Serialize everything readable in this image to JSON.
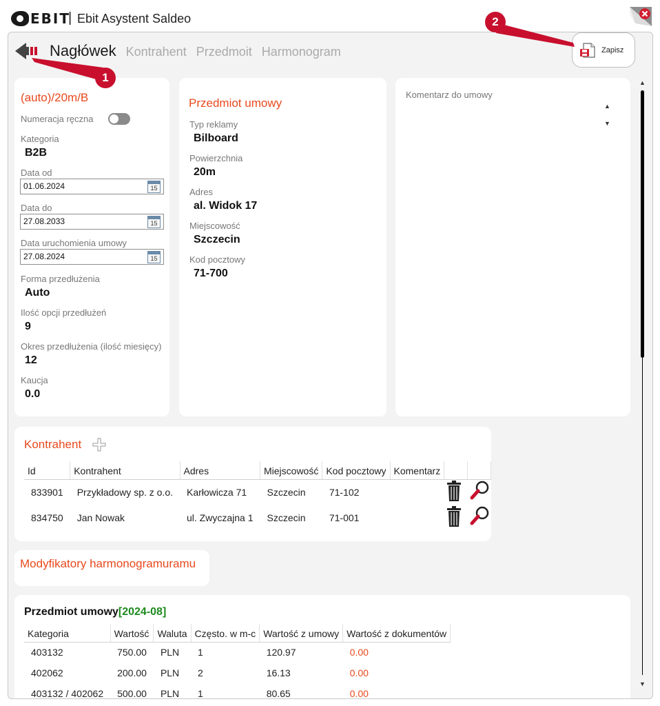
{
  "app": {
    "logo": "EBIT",
    "separator": "|",
    "title": "Ebit Asystent Saldeo"
  },
  "tabs": [
    {
      "label": "Nagłówek",
      "active": true
    },
    {
      "label": "Kontrahent",
      "active": false
    },
    {
      "label": "Przedmoit",
      "active": false
    },
    {
      "label": "Harmonogram",
      "active": false
    }
  ],
  "save_label": "Zapisz",
  "annotations": [
    "1",
    "2"
  ],
  "header": {
    "contract_no": "(auto)/20m/B",
    "manual_numbering_label": "Numeracja ręczna",
    "manual_numbering": false,
    "category_label": "Kategoria",
    "category": "B2B",
    "date_from_label": "Data od",
    "date_from": "01.06.2024",
    "date_to_label": "Data do",
    "date_to": "27.08.2033",
    "launch_date_label": "Data uruchomienia umowy",
    "launch_date": "27.08.2024",
    "calendar_day": "15",
    "extension_form_label": "Forma przedłużenia",
    "extension_form": "Auto",
    "extension_count_label": "Ilość opcji przedłużeń",
    "extension_count": "9",
    "extension_period_label": "Okres przedłużenia (ilość miesięcy)",
    "extension_period": "12",
    "deposit_label": "Kaucja",
    "deposit": "0.0"
  },
  "subject": {
    "title": "Przedmiot umowy",
    "type_label": "Typ reklamy",
    "type": "Bilboard",
    "area_label": "Powierzchnia",
    "area": "20m",
    "address_label": "Adres",
    "address": "al. Widok 17",
    "city_label": "Miejscowość",
    "city": "Szczecin",
    "postal_label": "Kod pocztowy",
    "postal": "71-700"
  },
  "comment": {
    "label": "Komentarz do umowy",
    "up": "▲",
    "down": "▼"
  },
  "contractors": {
    "title": "Kontrahent",
    "add_icon": "plus-icon",
    "columns": [
      "Id",
      "Kontrahent",
      "Adres",
      "Miejscowość",
      "Kod pocztowy",
      "Komentarz",
      "",
      ""
    ],
    "rows": [
      {
        "id": "833901",
        "name": "Przykładowy sp. z o.o.",
        "address": "Karłowicza 71",
        "city": "Szczecin",
        "postal": "71-102",
        "comment": ""
      },
      {
        "id": "834750",
        "name": "Jan Nowak",
        "address": "ul. Zwyczajna 1",
        "city": "Szczecin",
        "postal": "71-001",
        "comment": ""
      }
    ]
  },
  "modifiers": {
    "title": "Modyfikatory harmonogramuramu"
  },
  "schedule": {
    "title": "Przedmiot umowy",
    "period": "[2024-08]",
    "columns": [
      "Kategoria",
      "Wartość",
      "Waluta",
      "Często. w m-c",
      "Wartość z umowy",
      "Wartość z dokumentów"
    ],
    "rows": [
      {
        "category": "403132",
        "value": "750.00",
        "currency": "PLN",
        "freq": "1",
        "contract_value": "120.97",
        "doc_value": "0.00"
      },
      {
        "category": "402062",
        "value": "200.00",
        "currency": "PLN",
        "freq": "2",
        "contract_value": "16.13",
        "doc_value": "0.00"
      },
      {
        "category": "403132 / 402062",
        "value": "500.00",
        "currency": "PLN",
        "freq": "1",
        "contract_value": "80.65",
        "doc_value": "0.00"
      }
    ]
  },
  "colors": {
    "accent": "#e8491d",
    "marker": "#c8102e",
    "period": "#1e8a1e"
  }
}
